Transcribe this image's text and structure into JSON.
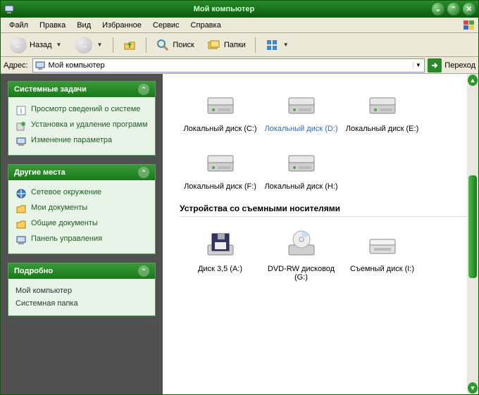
{
  "window": {
    "title": "Мой компьютер"
  },
  "menu": {
    "items": [
      "Файл",
      "Правка",
      "Вид",
      "Избранное",
      "Сервис",
      "Справка"
    ]
  },
  "toolbar": {
    "back": "Назад",
    "search": "Поиск",
    "folders": "Папки"
  },
  "address": {
    "label": "Адрес:",
    "value": "Мой компьютер",
    "go": "Переход"
  },
  "side": {
    "tasks": {
      "title": "Системные задачи",
      "items": [
        "Просмотр сведений о системе",
        "Установка и удаление программ",
        "Изменение параметра"
      ]
    },
    "places": {
      "title": "Другие места",
      "items": [
        "Сетевое окружение",
        "Мои документы",
        "Общие документы",
        "Панель управления"
      ]
    },
    "detail": {
      "title": "Подробно",
      "lines": [
        "Мой компьютер",
        "Системная папка"
      ]
    }
  },
  "main": {
    "drives": [
      {
        "label": "Локальный диск (C:)",
        "type": "hdd"
      },
      {
        "label": "Локальный диск (D:)",
        "type": "hdd",
        "selected": true
      },
      {
        "label": "Локальный диск (E:)",
        "type": "hdd"
      },
      {
        "label": "Локальный диск (F:)",
        "type": "hdd"
      },
      {
        "label": "Локальный диск (H:)",
        "type": "hdd"
      }
    ],
    "removable_head": "Устройства со съемными носителями",
    "removable": [
      {
        "label": "Диск 3,5 (A:)",
        "type": "floppy"
      },
      {
        "label": "DVD-RW дисковод (G:)",
        "type": "dvd"
      },
      {
        "label": "Съемный диск (I:)",
        "type": "removable"
      }
    ]
  }
}
